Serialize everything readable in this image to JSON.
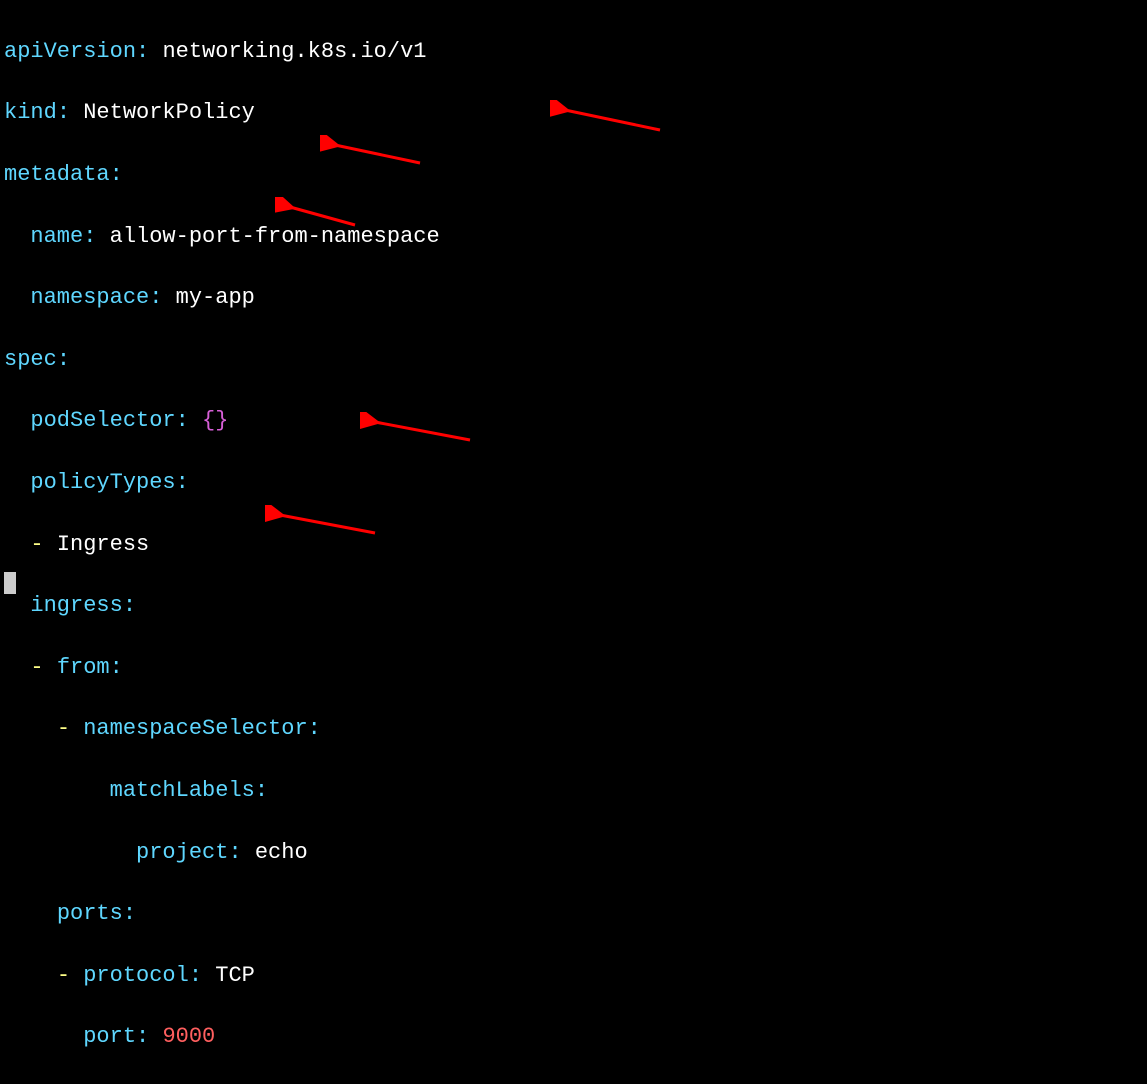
{
  "yaml": {
    "apiVersion": {
      "key": "apiVersion",
      "value": "networking.k8s.io/v1"
    },
    "kind": {
      "key": "kind",
      "value": "NetworkPolicy"
    },
    "metadata": {
      "key": "metadata"
    },
    "name": {
      "key": "name",
      "value": "allow-port-from-namespace"
    },
    "namespace": {
      "key": "namespace",
      "value": "my-app"
    },
    "spec": {
      "key": "spec"
    },
    "podSelector": {
      "key": "podSelector",
      "value": "{}"
    },
    "policyTypes": {
      "key": "policyTypes"
    },
    "ingressItem": {
      "value": "Ingress"
    },
    "ingress": {
      "key": "ingress"
    },
    "from": {
      "key": "from"
    },
    "namespaceSelector": {
      "key": "namespaceSelector"
    },
    "matchLabels": {
      "key": "matchLabels"
    },
    "project": {
      "key": "project",
      "value": "echo"
    },
    "ports": {
      "key": "ports"
    },
    "protocol": {
      "key": "protocol",
      "value": "TCP"
    },
    "port": {
      "key": "port",
      "value": "9000"
    }
  },
  "punctuation": {
    "colon": ":",
    "dash": "-"
  }
}
